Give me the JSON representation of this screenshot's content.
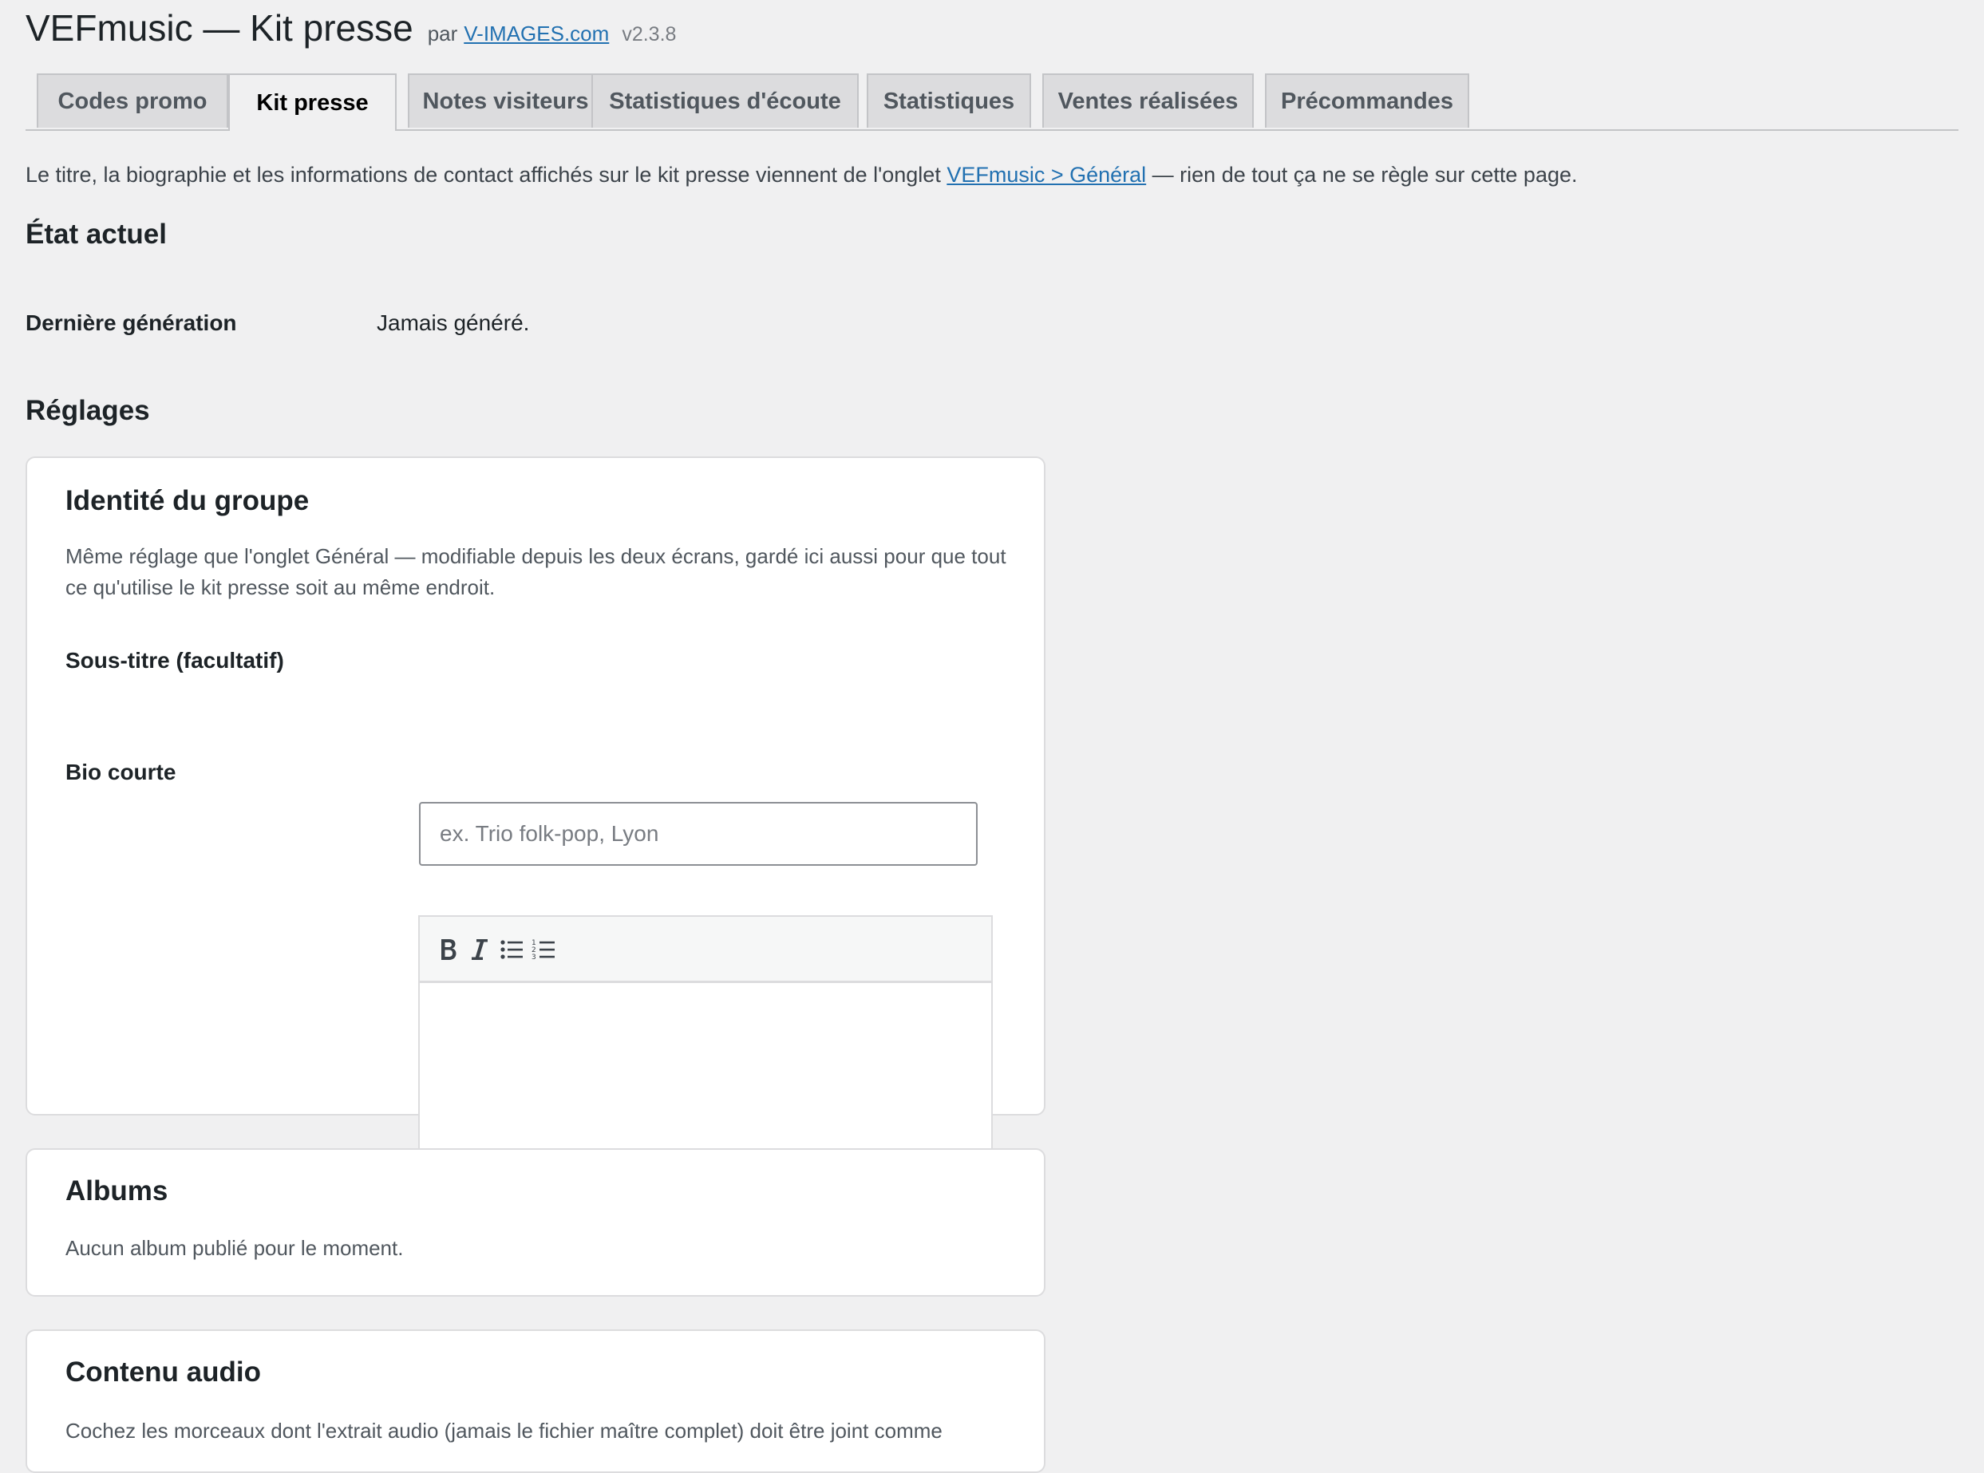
{
  "header": {
    "title": "VEFmusic — Kit presse",
    "by_label": "par",
    "by_link": "V-IMAGES.com",
    "version": "v2.3.8"
  },
  "tabs": [
    {
      "label": "Codes promo",
      "active": false
    },
    {
      "label": "Kit presse",
      "active": true
    },
    {
      "label": "Notes visiteurs",
      "active": false
    },
    {
      "label": "Statistiques d'écoute",
      "active": false
    },
    {
      "label": "Statistiques",
      "active": false
    },
    {
      "label": "Ventes réalisées",
      "active": false
    },
    {
      "label": "Précommandes",
      "active": false
    }
  ],
  "intro": {
    "before": "Le titre, la biographie et les informations de contact affichés sur le kit presse viennent de l'onglet ",
    "link": "VEFmusic > Général",
    "after": " — rien de tout ça ne se règle sur cette page."
  },
  "state": {
    "heading": "État actuel",
    "last_generation_label": "Dernière génération",
    "last_generation_value": "Jamais généré."
  },
  "settings": {
    "heading": "Réglages",
    "identity": {
      "title": "Identité du groupe",
      "description": "Même réglage que l'onglet Général — modifiable depuis les deux écrans, gardé ici aussi pour que tout ce qu'utilise le kit presse soit au même endroit.",
      "subtitle_label": "Sous-titre (facultatif)",
      "subtitle_value": "",
      "subtitle_placeholder": "ex. Trio folk-pop, Lyon",
      "bio_label": "Bio courte",
      "bio_value": "",
      "toolbar": [
        "bold-icon",
        "italic-icon",
        "bullet-list-icon",
        "numbered-list-icon"
      ]
    },
    "albums": {
      "title": "Albums",
      "description": "Aucun album publié pour le moment."
    },
    "audio": {
      "title": "Contenu audio",
      "description": "Cochez les morceaux dont l'extrait audio (jamais le fichier maître complet) doit être joint comme"
    }
  },
  "colors": {
    "background": "#f0f0f1",
    "link": "#2271b1",
    "card": "#ffffff",
    "tab_inactive": "#dcdcde"
  }
}
